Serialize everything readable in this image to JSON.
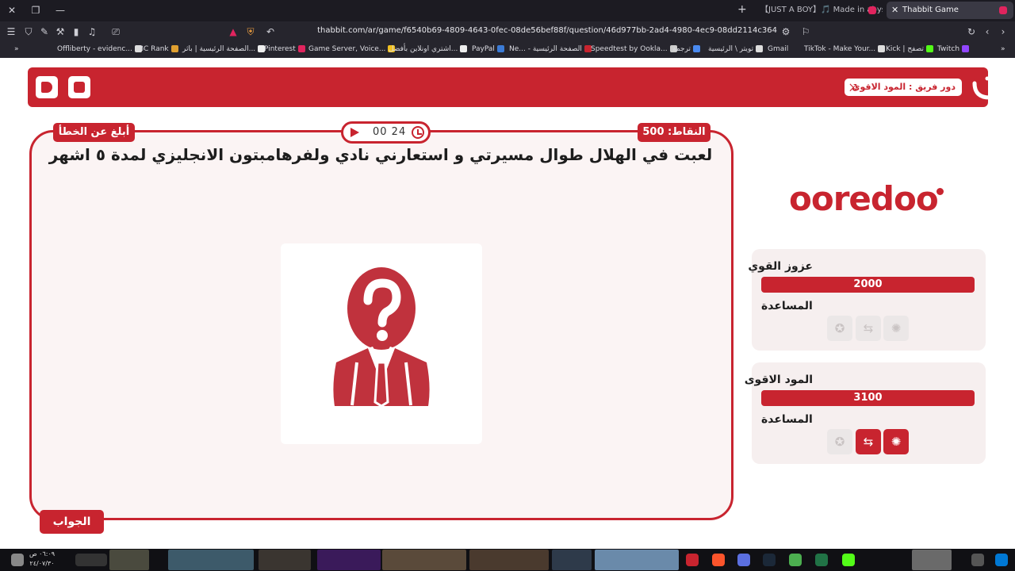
{
  "browser": {
    "tabs": [
      {
        "title": "【JUST A BOY】🎵 Made in abyss AMV",
        "active": false
      },
      {
        "title": "Thabbit Game",
        "active": true
      }
    ],
    "url": "thabbit.com/ar/game/f6540b69-4809-4643-0fec-08de56bef88f/question/46d977bb-2ad4-4980-4ec9-08dd2114c364",
    "bookmarks": [
      "Offliberty - evidenc...",
      "BC Rank",
      "الصفحة الرئيسية | باثر...",
      "Pinterest",
      "Game Server, Voice...",
      "اشتري اونلاين بأفضل...",
      "PayPal",
      "Ne... - الصفحة الرئيسية",
      "Speedtest by Ookla...",
      "ترجمة",
      "تويتر \\ الرئيسية",
      "Gmail",
      "TikTok - Make Your...",
      "Kick | تصفح",
      "Twitch"
    ],
    "accent": "#c8242f"
  },
  "header": {
    "turn_label": "دور فريق : المود الاقوى"
  },
  "game": {
    "report_label": "أبلغ عن الخطأ",
    "points_label": "النقاط: 500",
    "timer": "00 24",
    "question": "لعبت في الهلال طوال مسيرتي و استعارني نادي ولفرهامبتون الانجليزي لمدة ٥ اشهر",
    "answer_label": "الجواب"
  },
  "sponsor": {
    "name": "ooredoo"
  },
  "teams": [
    {
      "name": "عزوز القوي",
      "score": "2000",
      "help_label": "المساعدة",
      "lifelines": [
        {
          "icon": "star-swap-icon",
          "active": false
        },
        {
          "icon": "swap-arrows-icon",
          "active": false
        },
        {
          "icon": "lightbulb-hint-icon",
          "active": false
        }
      ]
    },
    {
      "name": "المود الاقوى",
      "score": "3100",
      "help_label": "المساعدة",
      "lifelines": [
        {
          "icon": "star-swap-icon",
          "active": false
        },
        {
          "icon": "swap-arrows-icon",
          "active": true
        },
        {
          "icon": "lightbulb-hint-icon",
          "active": true
        }
      ]
    }
  ],
  "taskbar": {
    "time": "٠٦:٠٩ ص",
    "date": "٢٤/٠٧/٣٠"
  }
}
